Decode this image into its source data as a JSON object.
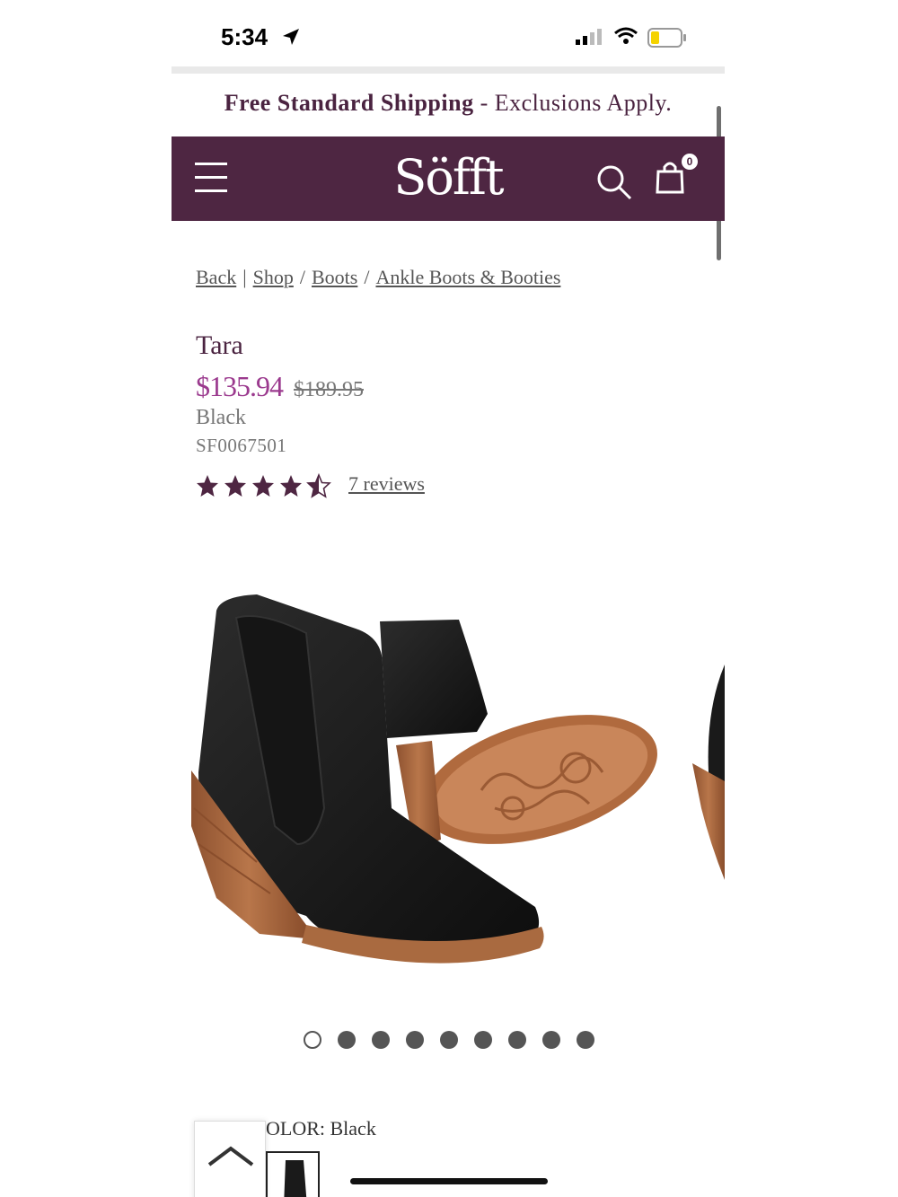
{
  "status_bar": {
    "time": "5:34",
    "icons": [
      "location-arrow-icon",
      "cell-signal-icon",
      "wifi-icon",
      "battery-low-icon"
    ]
  },
  "promo": {
    "bold": "Free Standard Shipping",
    "separator": " - ",
    "rest": "Exclusions Apply."
  },
  "header": {
    "logo": "Söfft",
    "cart_count": "0",
    "bg_color": "#4e2642",
    "icons": [
      "hamburger-menu-icon",
      "search-icon",
      "shopping-bag-icon"
    ]
  },
  "breadcrumb": {
    "back": "Back",
    "sep1": "|",
    "items": [
      "Shop",
      "Boots",
      "Ankle Boots & Booties"
    ],
    "sep": "/"
  },
  "product": {
    "name": "Tara",
    "sale_price": "$135.94",
    "original_price": "$189.95",
    "color": "Black",
    "sku": "SF0067501",
    "rating": 4.5,
    "rating_max": 5,
    "reviews": "7 reviews",
    "accent_color": "#9b3a8e"
  },
  "gallery": {
    "slide_count": 9,
    "active_slide": 1
  },
  "color_selector": {
    "label": "OLOR: Black"
  }
}
